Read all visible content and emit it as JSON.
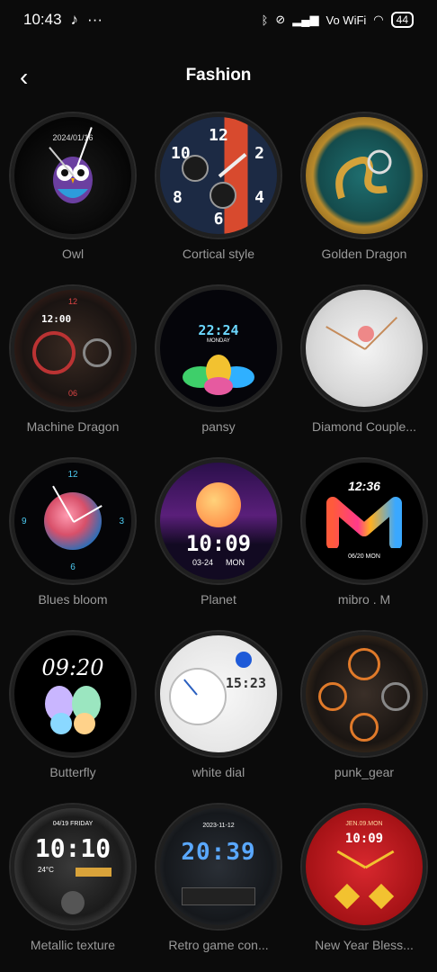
{
  "status": {
    "time": "10:43",
    "battery": "44",
    "network": "Vo WiFi"
  },
  "header": {
    "title": "Fashion",
    "back_icon": "chevron-left-icon"
  },
  "faces": [
    {
      "name": "Owl",
      "date": "2024/01/16"
    },
    {
      "name": "Cortical style"
    },
    {
      "name": "Golden Dragon"
    },
    {
      "name": "Machine Dragon",
      "time": "12:00"
    },
    {
      "name": "pansy",
      "time": "22:24",
      "day": "MONDAY"
    },
    {
      "name": "Diamond Couple..."
    },
    {
      "name": "Blues bloom"
    },
    {
      "name": "Planet",
      "time": "10:09",
      "date": "03-24",
      "day": "MON"
    },
    {
      "name": "mibro . M",
      "time": "12:36",
      "date": "06/20 MON"
    },
    {
      "name": "Butterfly",
      "time": "09:20"
    },
    {
      "name": "white dial",
      "time": "15:23"
    },
    {
      "name": "punk_gear"
    },
    {
      "name": "Metallic texture",
      "time": "10:10",
      "date": "04/19 FRIDAY",
      "temp": "24°C"
    },
    {
      "name": "Retro game con...",
      "time": "20:39",
      "date": "2023-11-12"
    },
    {
      "name": "New Year Bless...",
      "time": "10:09",
      "date": "JEN.09.MON"
    }
  ]
}
